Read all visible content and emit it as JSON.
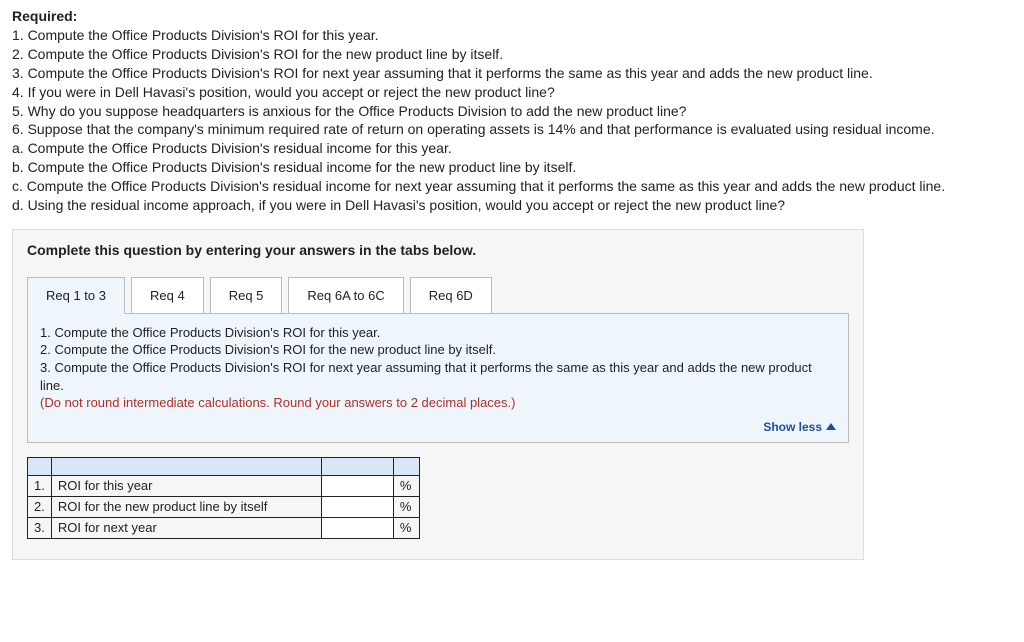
{
  "heading": "Required:",
  "requirements": [
    "1. Compute the Office Products Division's ROI for this year.",
    "2. Compute the Office Products Division's ROI for the new product line by itself.",
    "3. Compute the Office Products Division's ROI for next year assuming that it performs the same as this year and adds the new product line.",
    "4. If you were in Dell Havasi's position, would you accept or reject the new product line?",
    "5. Why do you suppose headquarters is anxious for the Office Products Division to add the new product line?",
    "6. Suppose that the company's minimum required rate of return on operating assets is 14% and that performance is evaluated using residual income.",
    "a. Compute the Office Products Division's residual income for this year.",
    "b. Compute the Office Products Division's residual income for the new product line by itself.",
    "c. Compute the Office Products Division's residual income for next year assuming that it performs the same as this year and adds the new product line.",
    "d. Using the residual income approach, if you were in Dell Havasi's position, would you accept or reject the new product line?"
  ],
  "panel_instruction": "Complete this question by entering your answers in the tabs below.",
  "tabs": [
    {
      "label": "Req 1 to 3"
    },
    {
      "label": "Req 4"
    },
    {
      "label": "Req 5"
    },
    {
      "label": "Req 6A to 6C"
    },
    {
      "label": "Req 6D"
    }
  ],
  "active_tab_content": [
    "1. Compute the Office Products Division's ROI for this year.",
    "2. Compute the Office Products Division's ROI for the new product line by itself.",
    "3. Compute the Office Products Division's ROI for next year assuming that it performs the same as this year and adds the new product line."
  ],
  "rounding_note": "(Do not round intermediate calculations. Round your answers to 2 decimal places.)",
  "show_less": "Show less",
  "table_rows": [
    {
      "num": "1.",
      "label": "ROI for this year",
      "value": "",
      "unit": "%"
    },
    {
      "num": "2.",
      "label": "ROI for the new product line by itself",
      "value": "",
      "unit": "%"
    },
    {
      "num": "3.",
      "label": "ROI for next year",
      "value": "",
      "unit": "%"
    }
  ]
}
